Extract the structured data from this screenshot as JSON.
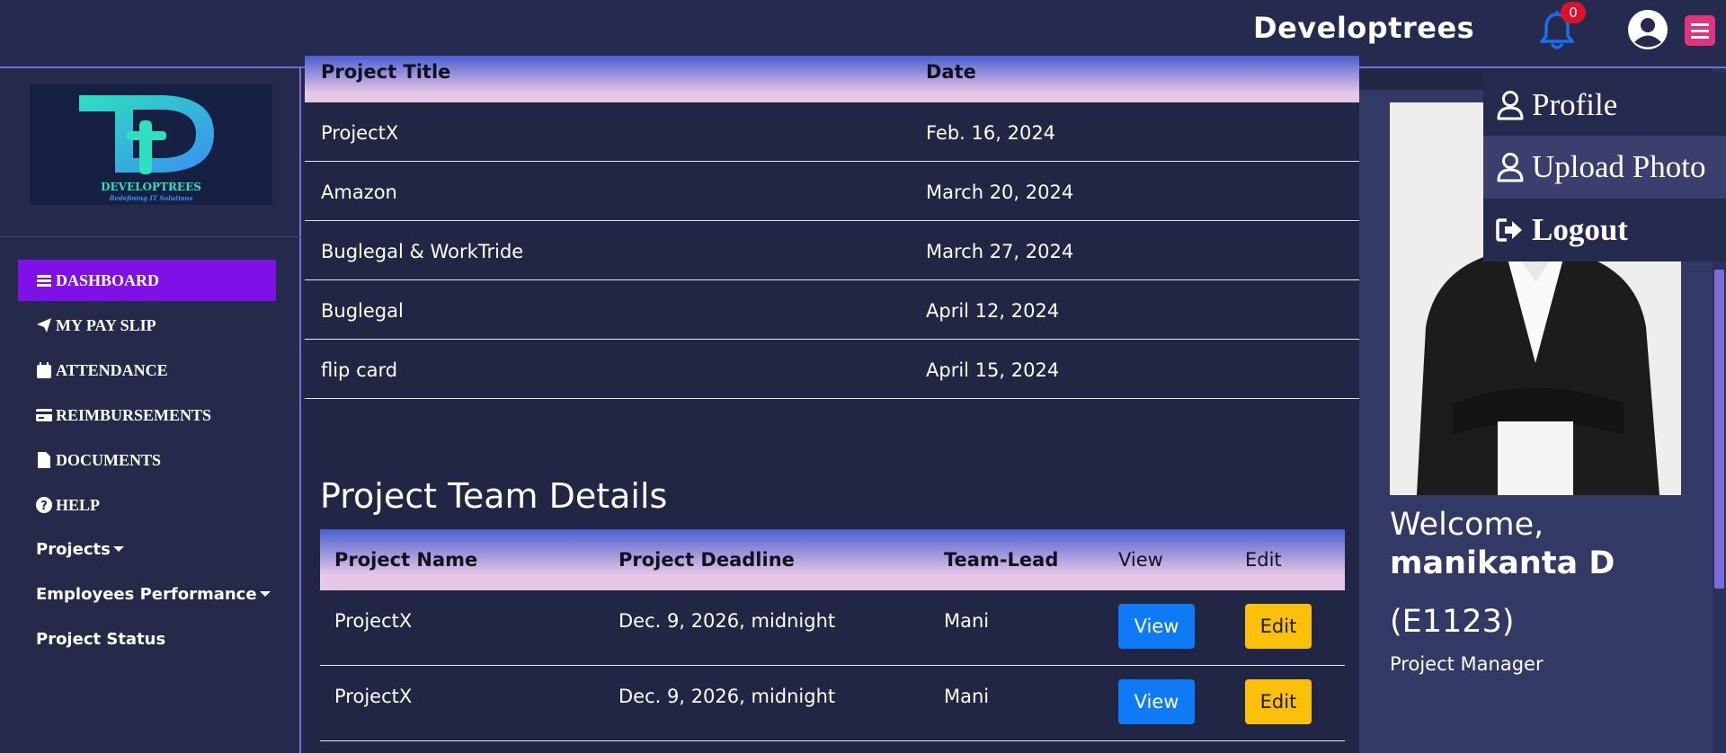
{
  "header": {
    "brand": "Developtrees",
    "notification_count": "0"
  },
  "logo": {
    "wordmark": "DEVELOPTREES",
    "tagline": "Redefining IT Solutions"
  },
  "sidebar": {
    "items": [
      {
        "label": "DASHBOARD",
        "icon": "bars-icon",
        "active": true
      },
      {
        "label": "MY PAY SLIP",
        "icon": "paper-plane-icon"
      },
      {
        "label": "ATTENDANCE",
        "icon": "calendar-icon"
      },
      {
        "label": "REIMBURSEMENTS",
        "icon": "credit-card-icon"
      },
      {
        "label": "DOCUMENTS",
        "icon": "file-icon"
      },
      {
        "label": "HELP",
        "icon": "question-circle-icon"
      },
      {
        "label": "Projects"
      },
      {
        "label": "Employees Performance"
      },
      {
        "label": "Project Status"
      }
    ]
  },
  "projects_table": {
    "headers": [
      "Project Title",
      "Date"
    ],
    "rows": [
      [
        "ProjectX",
        "Feb. 16, 2024"
      ],
      [
        "Amazon",
        "March 20, 2024"
      ],
      [
        "Buglegal & WorkTride",
        "March 27, 2024"
      ],
      [
        "Buglegal",
        "April 12, 2024"
      ],
      [
        "flip card",
        "April 15, 2024"
      ]
    ]
  },
  "team": {
    "title": "Project Team Details",
    "headers": [
      "Project Name",
      "Project Deadline",
      "Team-Lead",
      "View",
      "Edit"
    ],
    "rows": [
      {
        "name": "ProjectX",
        "deadline": "Dec. 9, 2026, midnight",
        "lead": "Mani",
        "view": "View",
        "edit": "Edit"
      },
      {
        "name": "ProjectX",
        "deadline": "Dec. 9, 2026, midnight",
        "lead": "Mani",
        "view": "View",
        "edit": "Edit"
      }
    ]
  },
  "profile": {
    "welcome": "Welcome,",
    "name": "manikanta  D",
    "code": "(E1123)",
    "role": "Project Manager"
  },
  "user_menu": {
    "profile": "Profile",
    "upload_photo": "Upload Photo",
    "logout": "Logout"
  },
  "colors": {
    "accent_purple": "#7f10e8",
    "view_button": "#0f7af6",
    "edit_button": "#fbc10a",
    "menu_button": "#e2347c"
  }
}
